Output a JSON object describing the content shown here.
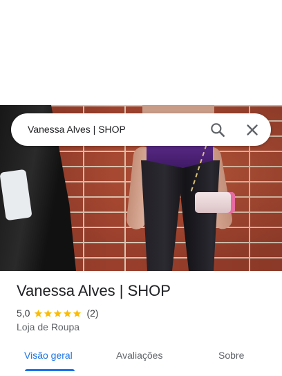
{
  "search": {
    "query": "Vanessa Alves | SHOP",
    "search_icon": "search-icon",
    "close_icon": "close-icon"
  },
  "place": {
    "name": "Vanessa Alves | SHOP",
    "rating": "5,0",
    "stars": 5,
    "review_count": "(2)",
    "category": "Loja de Roupa"
  },
  "tabs": [
    {
      "label": "Visão geral",
      "active": true
    },
    {
      "label": "Avaliações",
      "active": false
    },
    {
      "label": "Sobre",
      "active": false
    }
  ],
  "colors": {
    "accent": "#1a73e8",
    "star": "#fbbc04",
    "text": "#202124",
    "secondary": "#5f6368"
  }
}
